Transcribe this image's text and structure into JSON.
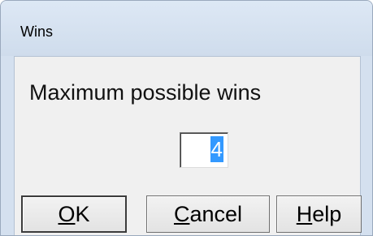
{
  "window": {
    "title": "Wins"
  },
  "dialog": {
    "prompt": "Maximum possible wins",
    "value": "4"
  },
  "buttons": {
    "ok": {
      "mnemonic": "O",
      "rest": "K"
    },
    "cancel": {
      "mnemonic": "C",
      "rest": "ancel"
    },
    "help": {
      "mnemonic": "H",
      "rest": "elp"
    }
  }
}
